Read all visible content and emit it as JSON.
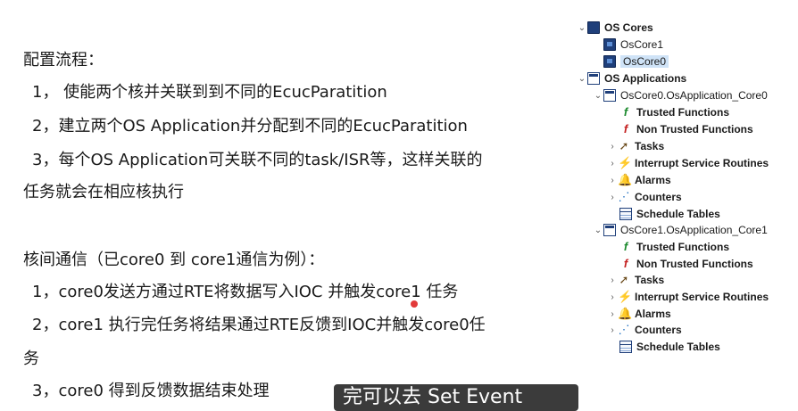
{
  "slide": {
    "heading1": "配置流程：",
    "steps1": [
      "1， 使能两个核并关联到到不同的EcucParatition",
      "2，建立两个OS Application并分配到不同的EcucParatition",
      "3，每个OS Application可关联不同的task/ISR等，这样关联的",
      "任务就会在相应核执行"
    ],
    "heading2": "核间通信（已core0 到 core1通信为例）：",
    "steps2": [
      "1，core0发送方通过RTE将数据写入IOC 并触发core1 任务",
      "2，core1 执行完任务将结果通过RTE反馈到IOC并触发core0任",
      "务",
      "3，core0 得到反馈数据结束处理"
    ]
  },
  "subtitle": "完可以去 Set Event",
  "tree": {
    "os_cores": "OS Cores",
    "core1": "OsCore1",
    "core0": "OsCore0",
    "os_apps": "OS Applications",
    "app0": "OsCore0.OsApplication_Core0",
    "app1": "OsCore1.OsApplication_Core1",
    "trusted": "Trusted Functions",
    "non_trusted": "Non Trusted Functions",
    "tasks": "Tasks",
    "isr": "Interrupt Service Routines",
    "alarms": "Alarms",
    "counters": "Counters",
    "schedule": "Schedule Tables"
  }
}
